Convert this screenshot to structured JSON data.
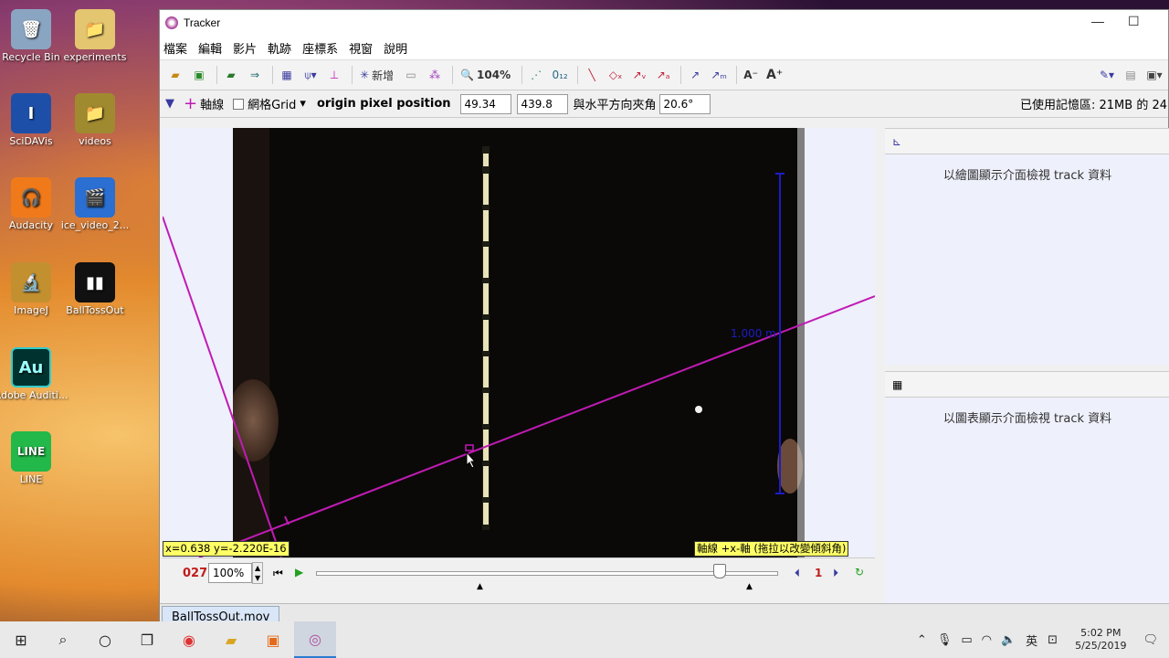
{
  "desktop": {
    "icons": [
      {
        "label": "Recycle Bin",
        "glyph": "🗑",
        "color": "#8aa5c2"
      },
      {
        "label": "experiments",
        "glyph": "📁",
        "color": "#e4c570"
      },
      {
        "label": "SciDAVis",
        "glyph": "I",
        "color": "#1e4fa8"
      },
      {
        "label": "videos",
        "glyph": "📁",
        "color": "#a08a30"
      },
      {
        "label": "Audacity",
        "glyph": "🎧",
        "color": "#f07a1a"
      },
      {
        "label": "ice_video_2...",
        "glyph": "🎬",
        "color": "#2a6fd1"
      },
      {
        "label": "ImageJ",
        "glyph": "🔬",
        "color": "#c39030"
      },
      {
        "label": "BallTossOut",
        "glyph": "▮▮",
        "color": "#111111"
      },
      {
        "label": "Adobe Auditi...",
        "glyph": "Au",
        "color": "#00332f"
      },
      {
        "label": "LINE",
        "glyph": "LINE",
        "color": "#22b84a"
      }
    ]
  },
  "window": {
    "title": "Tracker",
    "minimize_glyph": "—",
    "maximize_glyph": "☐",
    "menu": [
      "檔案",
      "編輯",
      "影片",
      "軌跡",
      "座標系",
      "視窗",
      "說明"
    ],
    "toolbar": {
      "new_label": "新增",
      "zoom_label": "104%"
    },
    "coordbar": {
      "axis_label": "軸線",
      "grid_label": "網格Grid",
      "origin_label": "origin pixel position",
      "origin_x": "49.34",
      "origin_y": "439.8",
      "angle_label": "與水平方向夾角",
      "angle_value": "20.6°",
      "memory_text": "已使用記憶區: 21MB 的 24"
    },
    "video": {
      "status_left": "x=0.638  y=-2.220E-16",
      "status_right": "軸線 +x-軸 (拖拉以改變傾斜角)",
      "scale_label": "1.000 m"
    },
    "playbar": {
      "frame": "027",
      "zoom": "100%",
      "step": "1"
    },
    "right": {
      "plot_text": "以繪圖顯示介面檢視 track 資料",
      "table_text": "以圖表顯示介面檢視 track 資料"
    },
    "tab_label": "BallTossOut.mov"
  },
  "taskbar": {
    "ime": "英",
    "time": "5:02 PM",
    "date": "5/25/2019"
  },
  "colors": {
    "axis": "#c01bb4",
    "calibration": "#1c1cc8",
    "accent": "#2b7bd0"
  }
}
